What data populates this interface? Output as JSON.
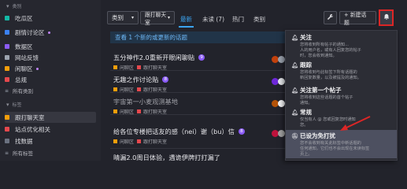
{
  "sidebar": {
    "section_categories": "类别",
    "categories": [
      {
        "label": "吃瓜区",
        "color": "#14b8a6"
      },
      {
        "label": "剧情讨论区",
        "color": "#3b82f6",
        "dot": true
      },
      {
        "label": "数据区",
        "color": "#8b5cf6"
      },
      {
        "label": "网站反馈",
        "color": "#9ca3af"
      },
      {
        "label": "闲聊区",
        "color": "#f59e0b",
        "dot": true
      },
      {
        "label": "总规",
        "color": "#e5484d"
      },
      {
        "label": "所有类别",
        "color": ""
      }
    ],
    "section_tags": "标签",
    "tags": [
      {
        "label": "跟打聊天室",
        "color": "#f59e0b",
        "active": true
      },
      {
        "label": "站点优化相关",
        "color": "#e5484d"
      },
      {
        "label": "找数据",
        "color": "#6b7280"
      },
      {
        "label": "所有标签",
        "color": ""
      }
    ]
  },
  "toolbar": {
    "category_label": "类别",
    "tag_label": "跟打聊天室",
    "tabs": [
      "最新",
      "未读 (7)",
      "热门",
      "类别"
    ],
    "wrench_icon": "wrench-icon",
    "new_topic_label": "+ 新建话题",
    "bell_icon": "bell-icon"
  },
  "banner": "查看 1 个新的或更新的话题",
  "topics": [
    {
      "title": "五分神作2.0重新开眼闲聊贴",
      "badge": "9",
      "cat": "闲聊区",
      "tag": "跟打聊天室",
      "read": false
    },
    {
      "title": "无趣之作讨论贴",
      "badge": "8",
      "cat": "闲聊区",
      "tag": "跟打聊天室",
      "read": false
    },
    {
      "title": "宇宙第一小麦观测基地",
      "badge": "",
      "cat": "闲聊区",
      "tag": "跟打聊天室",
      "read": true
    },
    {
      "title": "给各位专楼把话友的感（nei）谢（bu）信",
      "badge": "8",
      "cat": "闲聊区",
      "tag": "跟打聊天室",
      "read": false
    },
    {
      "title": "晴漏2.0周日体验，遇诡伊牌打打漏了",
      "badge": "",
      "cat": "",
      "tag": "",
      "read": false
    }
  ],
  "dropdown": [
    {
      "icon": "bell-icon",
      "label": "关注",
      "desc": [
        "您将收到所有帖子的通知...",
        "人的用户名，或有人回复您的帖子",
        "时，您会收到通知。"
      ]
    },
    {
      "icon": "bell-icon",
      "label": "跟踪",
      "desc": [
        "您将收到与此标签下所有话题的",
        "新回复数量，以及被提及的通知。"
      ]
    },
    {
      "icon": "bell-icon",
      "label": "关注第一个帖子",
      "desc": [
        "您将收到这些话题的首个帖子",
        "通知。"
      ]
    },
    {
      "icon": "bell-icon",
      "label": "常规",
      "desc": [
        "仅当有人 @ 您或回复您时通知",
        "您。"
      ]
    },
    {
      "icon": "bell-slash-icon",
      "label": "已设为免打扰",
      "desc": [
        "您不会收到有关此标签中新话题的",
        "任何通知，它们也不会出现在未读标签",
        "页上。"
      ],
      "selected": true
    }
  ],
  "colors": {
    "accent": "#3ba3f0",
    "highlight": "#dc2626"
  }
}
